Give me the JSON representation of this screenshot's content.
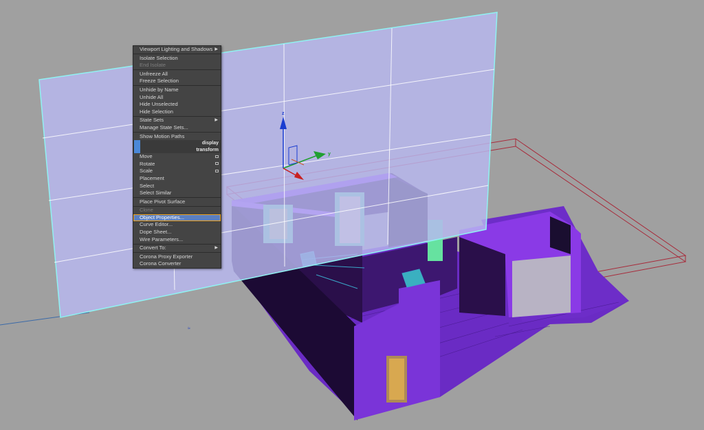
{
  "viewport": {
    "background": "#a0a0a0"
  },
  "gizmo": {
    "z_label": "z",
    "y_label": "y",
    "x_label": "x"
  },
  "quad_menu": {
    "items": [
      {
        "label": "Viewport Lighting and Shadows",
        "submenu": true
      },
      {
        "separator": true
      },
      {
        "label": "Isolate Selection"
      },
      {
        "label": "End Isolate",
        "disabled": true
      },
      {
        "separator": true
      },
      {
        "label": "Unfreeze All"
      },
      {
        "label": "Freeze Selection"
      },
      {
        "separator": true
      },
      {
        "label": "Unhide by Name"
      },
      {
        "label": "Unhide All"
      },
      {
        "label": "Hide Unselected"
      },
      {
        "label": "Hide Selection"
      },
      {
        "separator": true
      },
      {
        "label": "State Sets",
        "submenu": true
      },
      {
        "label": "Manage State Sets..."
      },
      {
        "separator": true
      },
      {
        "label": "Show Motion Paths"
      },
      {
        "header": "display"
      },
      {
        "header": "transform"
      },
      {
        "label": "Move",
        "box": true
      },
      {
        "label": "Rotate",
        "box": true
      },
      {
        "label": "Scale",
        "box": true
      },
      {
        "label": "Placement"
      },
      {
        "label": "Select"
      },
      {
        "label": "Select Similar"
      },
      {
        "separator": true
      },
      {
        "label": "Place Pivot Surface"
      },
      {
        "separator": true
      },
      {
        "label": "Clone",
        "disabled": true
      },
      {
        "label": "Object Properties...",
        "highlighted": true
      },
      {
        "label": "Curve Editor..."
      },
      {
        "label": "Dope Sheet..."
      },
      {
        "label": "Wire Parameters..."
      },
      {
        "separator": true
      },
      {
        "label": "Convert To:",
        "submenu": true
      },
      {
        "separator": true
      },
      {
        "label": "Corona Proxy Exporter"
      },
      {
        "label": "Corona Converter"
      }
    ]
  }
}
